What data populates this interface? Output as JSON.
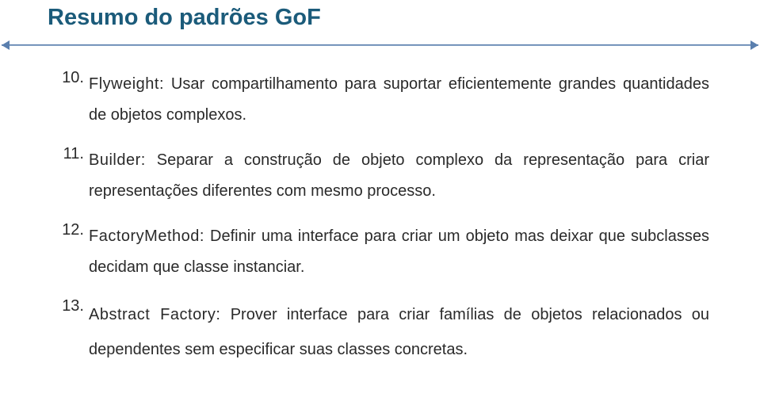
{
  "title": "Resumo do padrões GoF",
  "items": [
    {
      "num": "10.",
      "lead": "Flyweight:",
      "rest": " Usar compartilhamento para suportar eficientemente grandes quantidades de objetos complexos."
    },
    {
      "num": "11.",
      "lead": "Builder:",
      "rest": " Separar a construção de objeto complexo da representação para criar representações diferentes com mesmo processo."
    },
    {
      "num": "12.",
      "lead": "FactoryMethod:",
      "rest": " Definir uma interface para criar um objeto mas deixar que subclasses decidam que classe instanciar."
    },
    {
      "num": "13.",
      "lead": "Abstract Factory:",
      "rest": " Prover interface para criar famílias de objetos relacionados ou dependentes sem especificar suas classes concretas."
    }
  ]
}
